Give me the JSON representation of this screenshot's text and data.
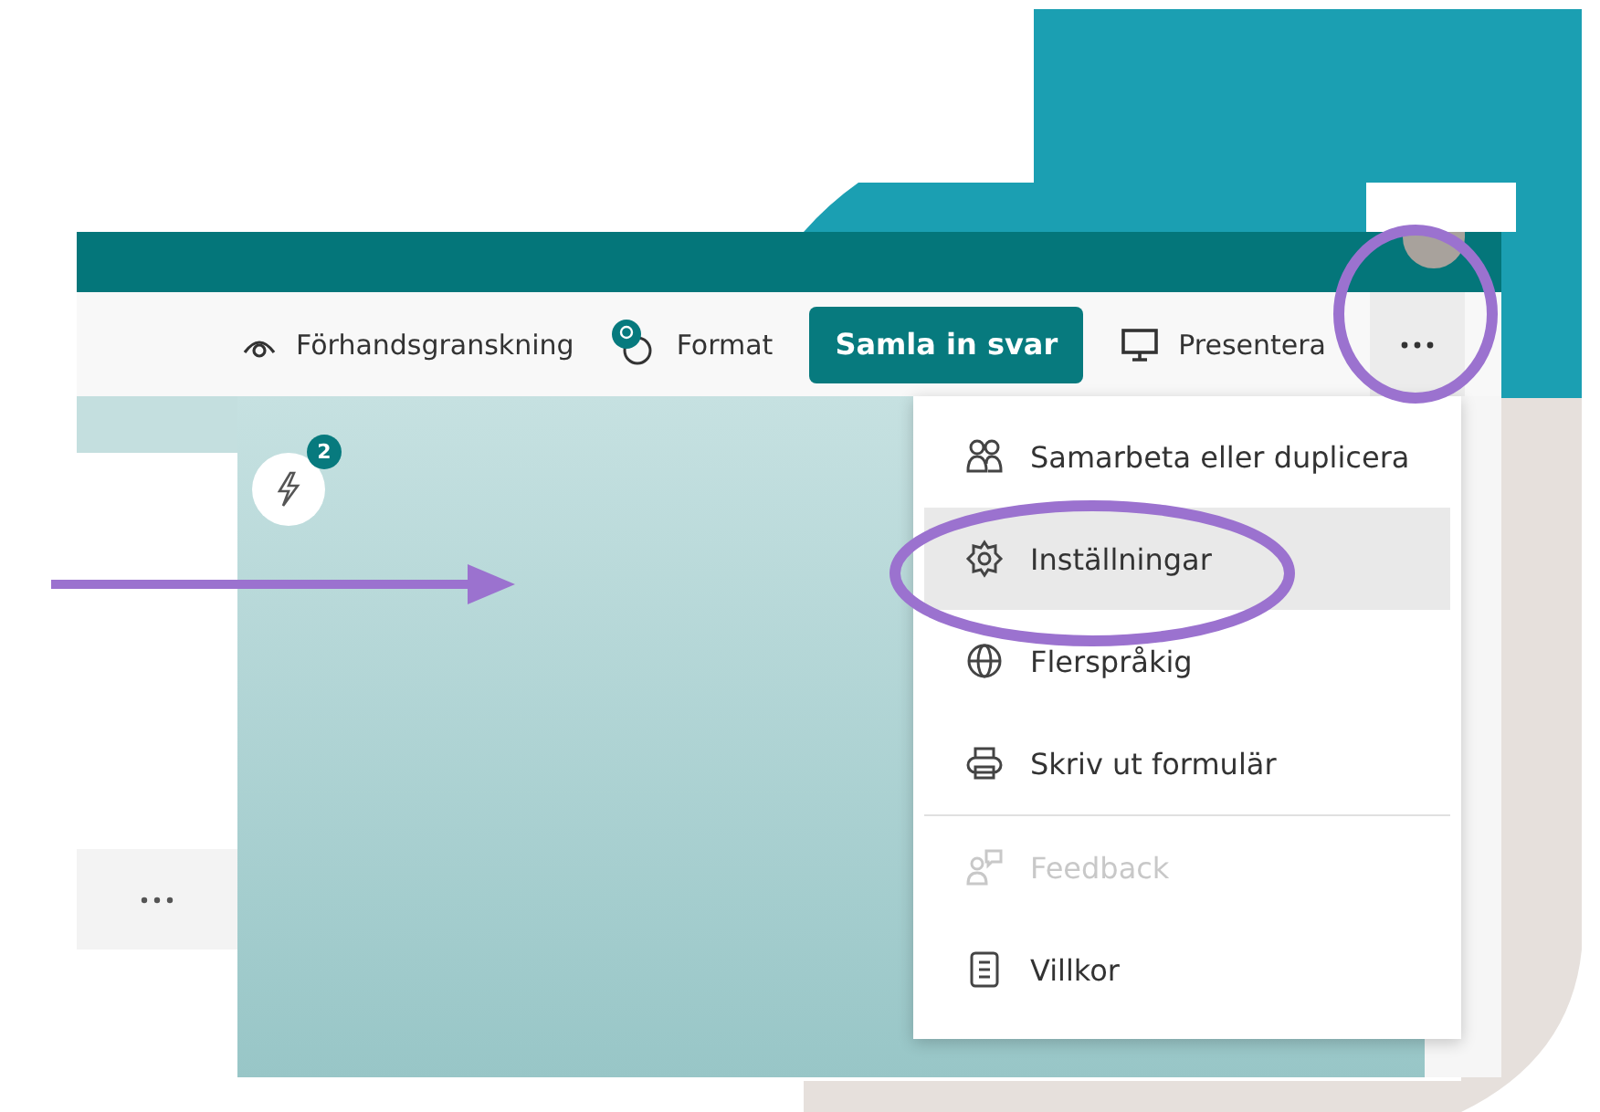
{
  "toolbar": {
    "preview": {
      "label": "Förhandsgranskning"
    },
    "format": {
      "label": "Format"
    },
    "collect": {
      "label": "Samla in svar"
    },
    "present": {
      "label": "Presentera"
    }
  },
  "ideas": {
    "badge": "2"
  },
  "menu": {
    "items": [
      {
        "label": "Samarbeta eller duplicera",
        "selected": false,
        "disabled": false,
        "divider_before": false
      },
      {
        "label": "Inställningar",
        "selected": true,
        "disabled": false,
        "divider_before": false
      },
      {
        "label": "Flerspråkig",
        "selected": false,
        "disabled": false,
        "divider_before": false
      },
      {
        "label": "Skriv ut formulär",
        "selected": false,
        "disabled": false,
        "divider_before": false
      },
      {
        "label": "Feedback",
        "selected": false,
        "disabled": true,
        "divider_before": true
      },
      {
        "label": "Villkor",
        "selected": false,
        "disabled": false,
        "divider_before": false
      }
    ]
  }
}
